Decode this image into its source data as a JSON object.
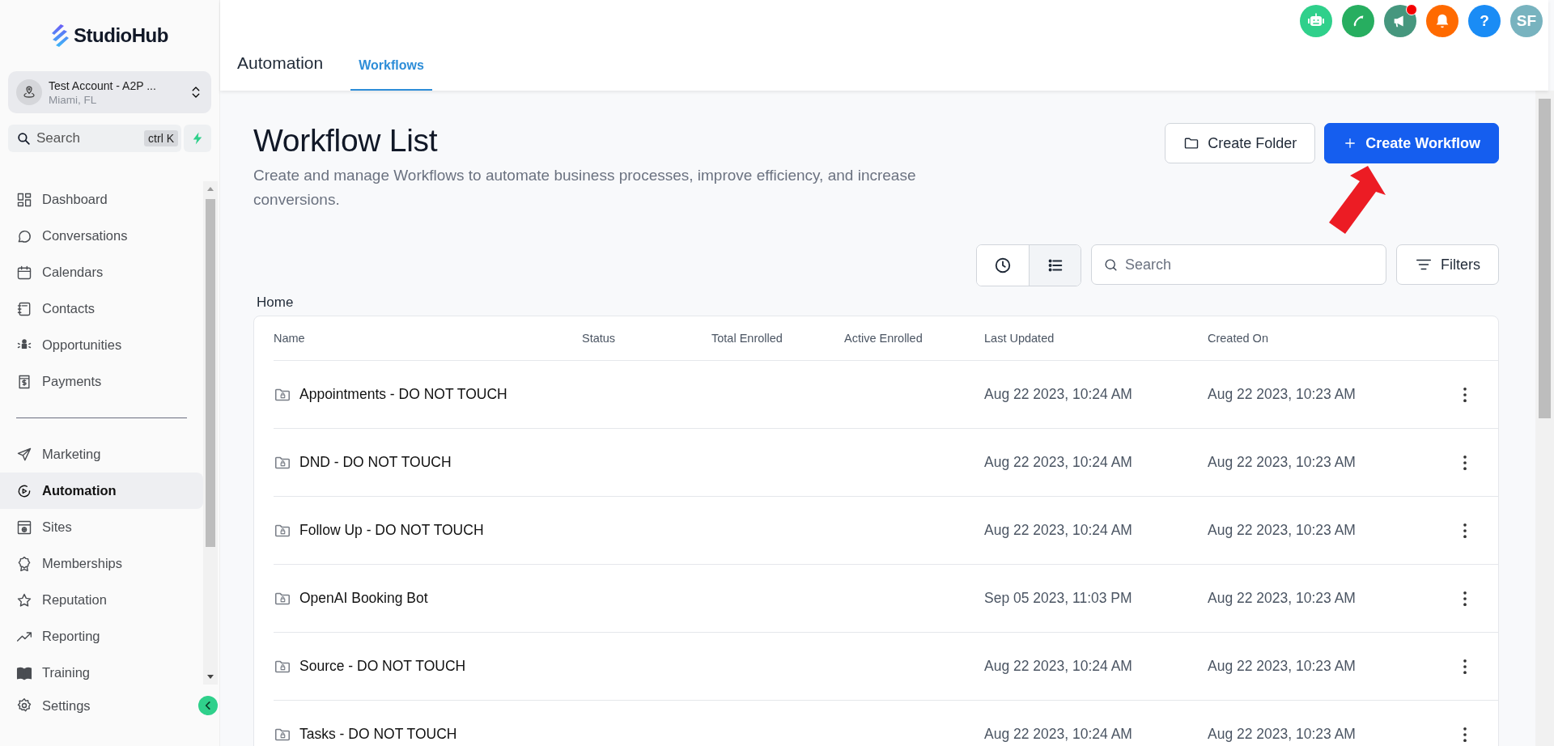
{
  "sidebar": {
    "logo": "StudioHub",
    "account": {
      "name": "Test Account - A2P ...",
      "location": "Miami, FL"
    },
    "search": {
      "placeholder": "Search",
      "shortcut": "ctrl K"
    },
    "items": [
      {
        "label": "Dashboard",
        "selected": false
      },
      {
        "label": "Conversations",
        "selected": false
      },
      {
        "label": "Calendars",
        "selected": false
      },
      {
        "label": "Contacts",
        "selected": false
      },
      {
        "label": "Opportunities",
        "selected": false
      },
      {
        "label": "Payments",
        "selected": false
      },
      {
        "kind": "divider"
      },
      {
        "label": "Marketing",
        "selected": false
      },
      {
        "label": "Automation",
        "selected": true
      },
      {
        "label": "Sites",
        "selected": false
      },
      {
        "label": "Memberships",
        "selected": false
      },
      {
        "label": "Reputation",
        "selected": false
      },
      {
        "label": "Reporting",
        "selected": false
      },
      {
        "label": "Training",
        "selected": false
      }
    ],
    "settings": "Settings"
  },
  "topbar": {
    "title": "Automation",
    "tabs": [
      {
        "label": "Workflows",
        "selected": true
      }
    ],
    "actions": [
      {
        "kind": "robot",
        "badge": false
      },
      {
        "kind": "phone",
        "badge": false
      },
      {
        "kind": "megaphone",
        "badge": true
      },
      {
        "kind": "bell",
        "badge": false
      },
      {
        "kind": "help",
        "text": "?",
        "badge": false
      },
      {
        "kind": "avatar",
        "text": "SF",
        "badge": false
      }
    ]
  },
  "page": {
    "title": "Workflow List",
    "subtitle": "Create and manage Workflows to automate business processes, improve efficiency, and increase conversions.",
    "buttons": [
      {
        "label": "Create Folder",
        "kind": "secondary"
      },
      {
        "label": "Create Workflow",
        "kind": "primary"
      }
    ],
    "views": [
      {
        "kind": "clock",
        "selected": false
      },
      {
        "kind": "list",
        "selected": true
      }
    ],
    "search": {
      "placeholder": "Search"
    },
    "filters": "Filters",
    "breadcrumb": "Home"
  },
  "table": {
    "columns": [
      "Name",
      "Status",
      "Total Enrolled",
      "Active Enrolled",
      "Last Updated",
      "Created On"
    ],
    "rows": [
      {
        "name": "Appointments - DO NOT TOUCH",
        "last_updated": "Aug 22 2023, 10:24 AM",
        "created_on": "Aug 22 2023, 10:23 AM"
      },
      {
        "name": "DND - DO NOT TOUCH",
        "last_updated": "Aug 22 2023, 10:24 AM",
        "created_on": "Aug 22 2023, 10:23 AM"
      },
      {
        "name": "Follow Up - DO NOT TOUCH",
        "last_updated": "Aug 22 2023, 10:24 AM",
        "created_on": "Aug 22 2023, 10:23 AM"
      },
      {
        "name": "OpenAI Booking Bot",
        "last_updated": "Sep 05 2023, 11:03 PM",
        "created_on": "Aug 22 2023, 10:23 AM"
      },
      {
        "name": "Source - DO NOT TOUCH",
        "last_updated": "Aug 22 2023, 10:24 AM",
        "created_on": "Aug 22 2023, 10:23 AM"
      },
      {
        "name": "Tasks - DO NOT TOUCH",
        "last_updated": "Aug 22 2023, 10:24 AM",
        "created_on": "Aug 22 2023, 10:23 AM"
      }
    ]
  }
}
